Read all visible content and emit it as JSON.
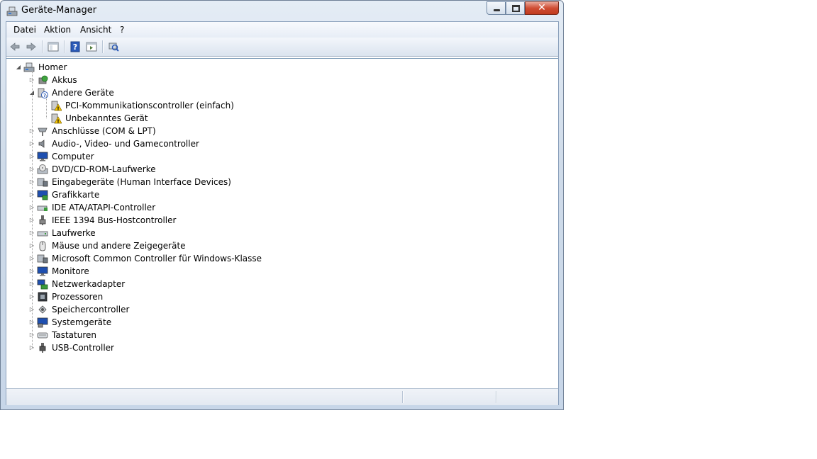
{
  "window": {
    "title": "Geräte-Manager",
    "title_icon": "device-manager-icon",
    "close_glyph": "✕",
    "accent_close": "#cf4d33"
  },
  "menubar": {
    "items": [
      "Datei",
      "Aktion",
      "Ansicht",
      "?"
    ]
  },
  "toolbar": {
    "icons": [
      "back-arrow-icon",
      "forward-arrow-icon",
      "show-hide-console-tree-icon",
      "help-icon",
      "properties-icon",
      "scan-hardware-icon"
    ]
  },
  "tree": {
    "root": {
      "label": "Homer",
      "icon": "computer-icon",
      "expanded": true
    },
    "categories": [
      {
        "label": "Akkus",
        "icon": "battery-icon",
        "expanded": false
      },
      {
        "label": "Andere Geräte",
        "icon": "unknown-device-icon",
        "expanded": true,
        "children": [
          {
            "label": "PCI-Kommunikationscontroller (einfach)",
            "icon": "warning-device-icon"
          },
          {
            "label": "Unbekanntes Gerät",
            "icon": "warning-device-icon"
          }
        ]
      },
      {
        "label": "Anschlüsse (COM & LPT)",
        "icon": "port-icon",
        "expanded": false
      },
      {
        "label": "Audio-, Video- und Gamecontroller",
        "icon": "speaker-icon",
        "expanded": false
      },
      {
        "label": "Computer",
        "icon": "monitor-icon",
        "expanded": false
      },
      {
        "label": "DVD/CD-ROM-Laufwerke",
        "icon": "dvd-drive-icon",
        "expanded": false
      },
      {
        "label": "Eingabegeräte (Human Interface Devices)",
        "icon": "hid-icon",
        "expanded": false
      },
      {
        "label": "Grafikkarte",
        "icon": "display-adapter-icon",
        "expanded": false
      },
      {
        "label": "IDE ATA/ATAPI-Controller",
        "icon": "ide-controller-icon",
        "expanded": false
      },
      {
        "label": "IEEE 1394 Bus-Hostcontroller",
        "icon": "firewire-icon",
        "expanded": false
      },
      {
        "label": "Laufwerke",
        "icon": "disk-drive-icon",
        "expanded": false
      },
      {
        "label": "Mäuse und andere Zeigegeräte",
        "icon": "mouse-icon",
        "expanded": false
      },
      {
        "label": "Microsoft Common Controller für Windows-Klasse",
        "icon": "controller-icon",
        "expanded": false
      },
      {
        "label": "Monitore",
        "icon": "monitor-icon",
        "expanded": false
      },
      {
        "label": "Netzwerkadapter",
        "icon": "network-adapter-icon",
        "expanded": false
      },
      {
        "label": "Prozessoren",
        "icon": "processor-icon",
        "expanded": false
      },
      {
        "label": "Speichercontroller",
        "icon": "storage-controller-icon",
        "expanded": false
      },
      {
        "label": "Systemgeräte",
        "icon": "system-devices-icon",
        "expanded": false
      },
      {
        "label": "Tastaturen",
        "icon": "keyboard-icon",
        "expanded": false
      },
      {
        "label": "USB-Controller",
        "icon": "usb-icon",
        "expanded": false
      }
    ]
  },
  "statusbar": {
    "panels": [
      "",
      "",
      ""
    ]
  }
}
